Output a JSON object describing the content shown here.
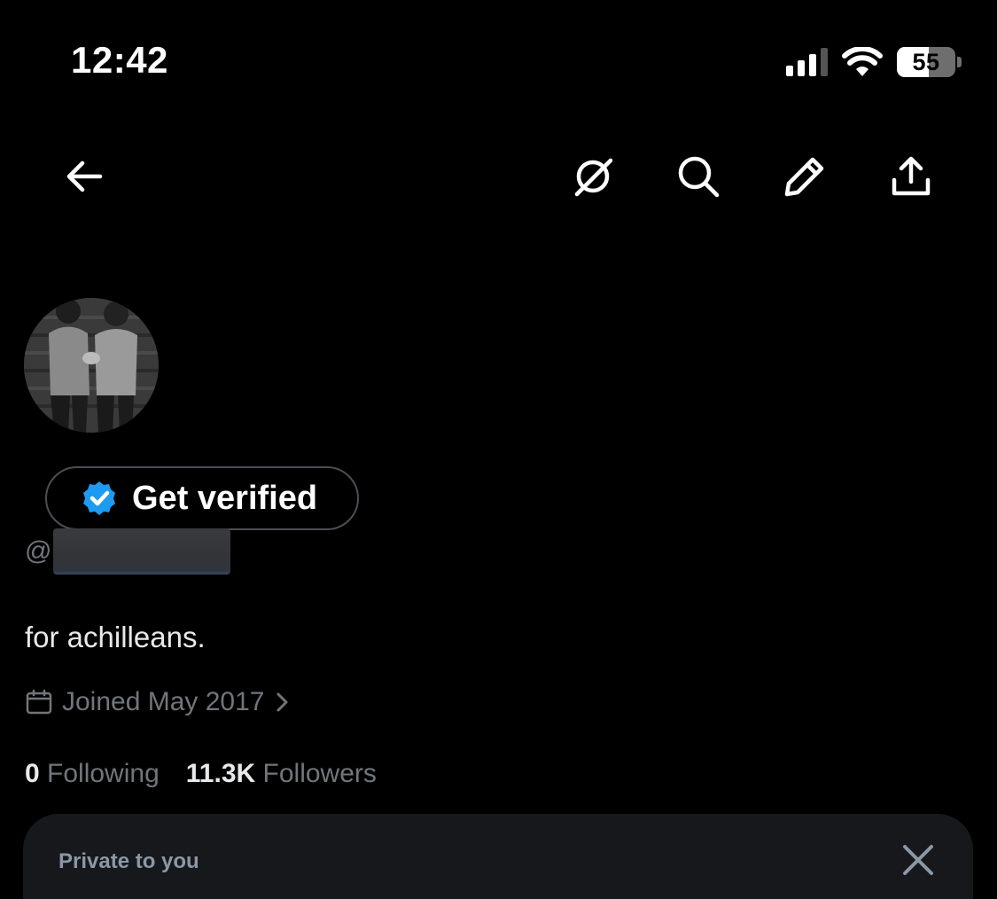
{
  "status_bar": {
    "time": "12:42",
    "battery_percent": "55",
    "battery_level": 0.55,
    "signal_bars_active": 3,
    "signal_bars_total": 4,
    "icons": [
      "signal-icon",
      "wifi-icon",
      "battery-icon"
    ]
  },
  "nav": {
    "icons": [
      "back-arrow-icon",
      "grok-icon",
      "search-icon",
      "edit-pencil-icon",
      "share-icon"
    ]
  },
  "profile": {
    "verify_label": "Get verified",
    "handle_prefix": "@",
    "bio": "for achilleans.",
    "joined": "Joined May 2017",
    "following_count": "0",
    "following_label": "Following",
    "followers_count": "11.3K",
    "followers_label": "Followers"
  },
  "private_card": {
    "title": "Private to you"
  },
  "colors": {
    "background": "#000000",
    "text_primary": "#e7e9ea",
    "text_secondary": "#71767b",
    "verified_badge": "#1d9bf0",
    "card_bg": "#16181c"
  }
}
